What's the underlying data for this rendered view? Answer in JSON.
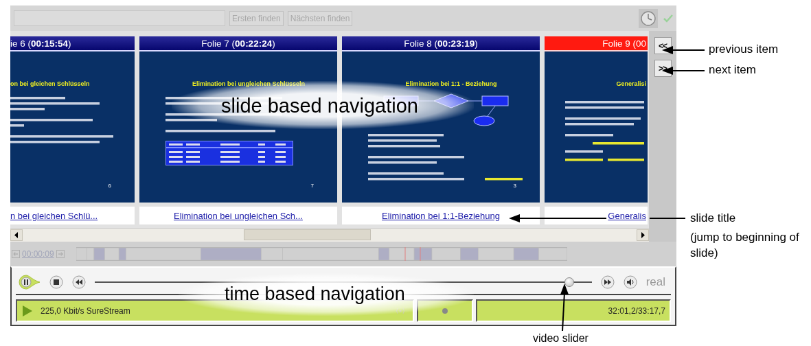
{
  "toolbar": {
    "buttons": [
      {
        "label": "Ersten finden",
        "disabled": true
      },
      {
        "label": "Nächsten finden",
        "disabled": true
      }
    ]
  },
  "slides": [
    {
      "header": "ie 6 (**00:15:54**)",
      "selected": false,
      "heading": "on bei gleichen Schlüsseln",
      "page": "6",
      "link": "n bei gleichen Schlü..."
    },
    {
      "header": "Folie 7 (**00:22:24**)",
      "selected": false,
      "heading": "Elimination bei ungleichen Schlüsseln",
      "page": "7",
      "link": "Elimination bei ungleichen Sch..."
    },
    {
      "header": "Folie 8 (**00:23:19**)",
      "selected": false,
      "heading": "Elimination bei 1:1 - Beziehung",
      "page": "3",
      "link": "Elimination bei 1:1-Beziehung"
    },
    {
      "header": "Folie 9 (00",
      "selected": true,
      "heading": "Generalisi",
      "link": "Generalis"
    }
  ],
  "nav_buttons": [
    {
      "label": "<<"
    },
    {
      "label": ">>"
    }
  ],
  "timeline": {
    "time": "00:00:09",
    "disabled": true
  },
  "player": {
    "playing": true,
    "slider": {
      "level": 0.955
    },
    "mode": "real",
    "status": {
      "bitrate": "225,0 Kbit/s SureStream",
      "time": "32:01,2/33:17,7"
    }
  },
  "overlays": [
    {
      "text": "slide based navigation"
    },
    {
      "text": "time based navigation"
    }
  ],
  "annotations": {
    "previous": "previous item",
    "next": "next item",
    "slide_title": "slide title",
    "slide_title_note": "(jump to beginning of slide)",
    "video_slider": "video slider"
  }
}
